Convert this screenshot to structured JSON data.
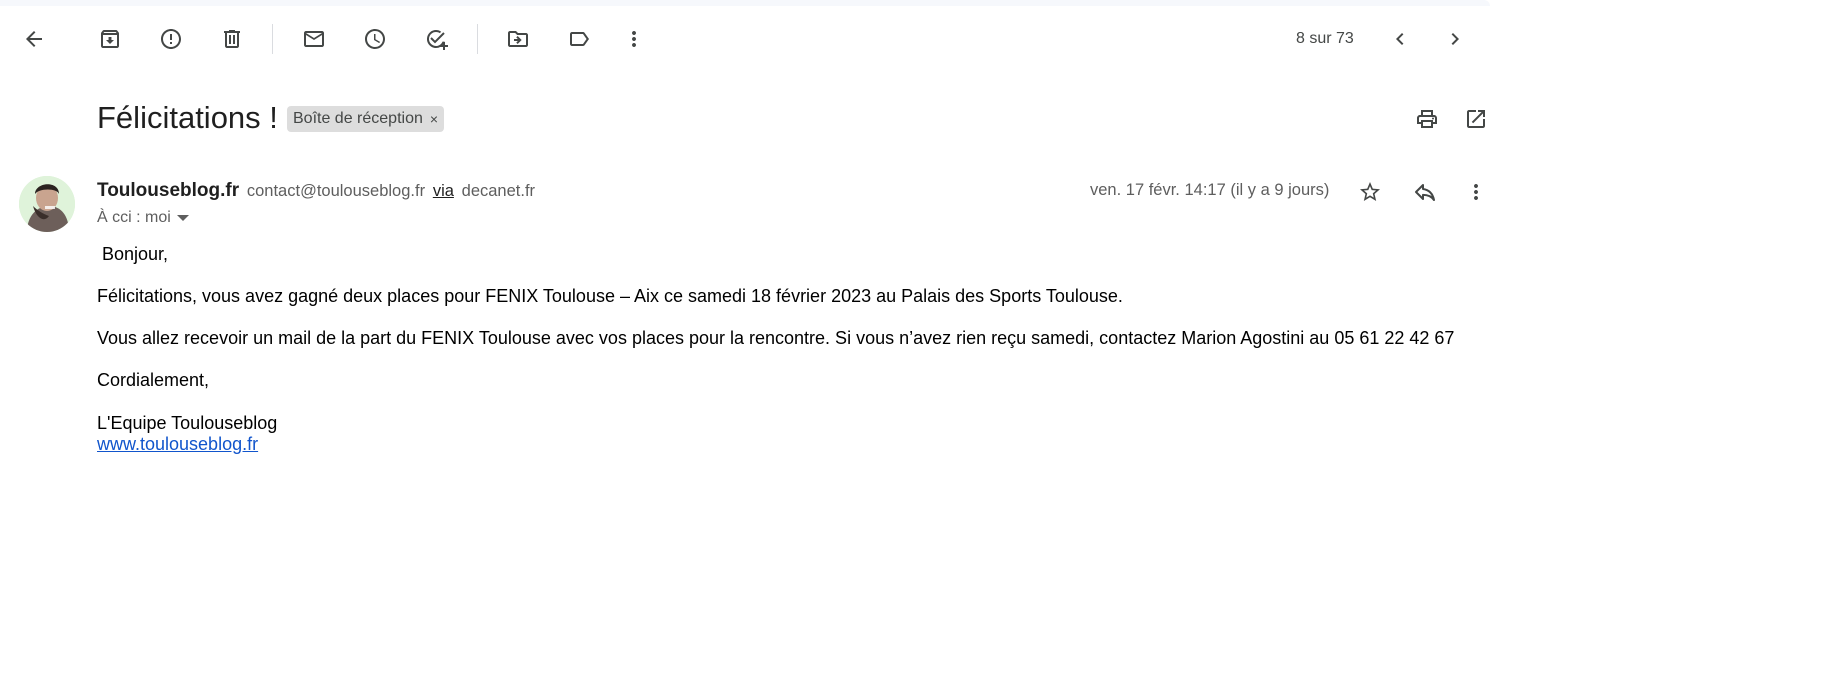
{
  "toolbar": {
    "pager_text": "8 sur 73"
  },
  "message": {
    "subject": "Félicitations !",
    "label": "Boîte de réception",
    "label_remove": "×",
    "sender_name": "Toulouseblog.fr",
    "sender_email": "contact@toulouseblog.fr",
    "via_label": "via",
    "via_domain": "decanet.fr",
    "recipients": "À cci : moi",
    "date": "ven. 17 févr. 14:17 (il y a 9 jours)"
  },
  "body": {
    "greeting": "Bonjour,",
    "paragraph1": "Félicitations, vous avez gagné deux places pour FENIX Toulouse – Aix ce samedi 18 février 2023 au Palais des Sports Toulouse.",
    "paragraph2": "Vous allez recevoir un mail de la part du FENIX Toulouse avec vos places pour la rencontre. Si vous n’avez rien reçu samedi, contactez Marion Agostini au  05 61 22 42 67",
    "closing": "Cordialement,",
    "signature": "L'Equipe Toulouseblog",
    "link": "www.toulouseblog.fr"
  },
  "colors": {
    "link": "#1155cc",
    "icon": "#444746",
    "chip_bg": "#dddddd"
  },
  "icons": [
    "back-arrow-icon",
    "archive-icon",
    "report-spam-icon",
    "delete-icon",
    "mark-unread-icon",
    "snooze-icon",
    "add-to-tasks-icon",
    "move-to-icon",
    "label-icon",
    "more-vert-icon",
    "chevron-left-icon",
    "chevron-right-icon",
    "print-icon",
    "open-new-window-icon",
    "star-icon",
    "reply-icon"
  ]
}
